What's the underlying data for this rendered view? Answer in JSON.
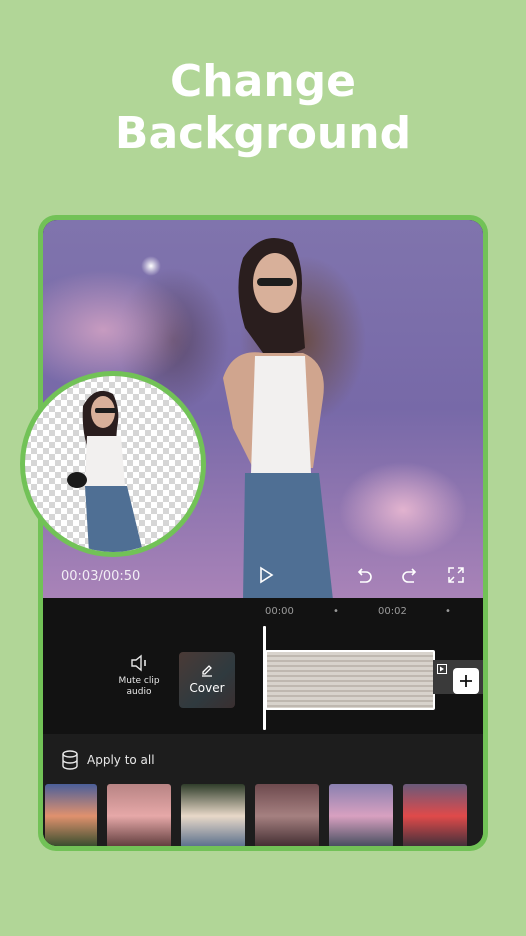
{
  "headline": {
    "line1": "Change",
    "line2": "Background"
  },
  "player": {
    "time_readout": "00:03/00:50",
    "play_icon": "play-icon",
    "undo_icon": "undo-icon",
    "redo_icon": "redo-icon",
    "fullscreen_icon": "fullscreen-icon"
  },
  "ruler": {
    "ticks": [
      "00:00",
      "•",
      "00:02",
      "•"
    ]
  },
  "timeline": {
    "mute_label_1": "Mute clip",
    "mute_label_2": "audio",
    "cover_label": "Cover",
    "add_icon": "plus-icon"
  },
  "background_panel": {
    "apply_all_label": "Apply to all",
    "thumbnails": [
      {
        "name": "sunset-clouds-field",
        "colors": [
          "#4b5f9a",
          "#e0916e",
          "#2f4a2a"
        ]
      },
      {
        "name": "pink-roses",
        "colors": [
          "#b88484",
          "#e6a8a8",
          "#5a3838"
        ]
      },
      {
        "name": "white-roses-dusk",
        "colors": [
          "#2f3d2a",
          "#e8d8c8",
          "#546b8a"
        ]
      },
      {
        "name": "pink-clouds-night",
        "colors": [
          "#6e4a4e",
          "#a58080",
          "#3e2a2e"
        ]
      },
      {
        "name": "flowers-purple-sky",
        "colors": [
          "#8a80b0",
          "#d8a0c0",
          "#3f4a5a"
        ]
      },
      {
        "name": "window-red-clouds",
        "colors": [
          "#6a5a7a",
          "#e04a4a",
          "#3a2f3a"
        ]
      }
    ]
  },
  "colors": {
    "background": "#b1d697",
    "frame": "#72c257",
    "panel": "#1d1d1d"
  }
}
